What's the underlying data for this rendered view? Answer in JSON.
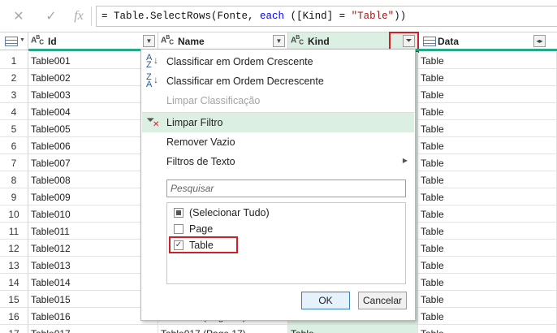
{
  "formula_bar": {
    "cancel_icon": "x-icon",
    "commit_icon": "check-icon",
    "fx_label": "fx",
    "formula_parts": [
      "= Table.SelectRows(Fonte, ",
      "each",
      " ([Kind] = ",
      "\"Table\"",
      "))"
    ]
  },
  "columns": [
    {
      "name": "Id",
      "type_label": "ABC"
    },
    {
      "name": "Name",
      "type_label": "ABC"
    },
    {
      "name": "Kind",
      "type_label": "ABC"
    },
    {
      "name": "Data",
      "type_label": "Table"
    }
  ],
  "rows": [
    {
      "n": "1",
      "id": "Table001",
      "name": "",
      "kind": "",
      "data": "Table"
    },
    {
      "n": "2",
      "id": "Table002",
      "name": "",
      "kind": "",
      "data": "Table"
    },
    {
      "n": "3",
      "id": "Table003",
      "name": "",
      "kind": "",
      "data": "Table"
    },
    {
      "n": "4",
      "id": "Table004",
      "name": "",
      "kind": "",
      "data": "Table"
    },
    {
      "n": "5",
      "id": "Table005",
      "name": "",
      "kind": "",
      "data": "Table"
    },
    {
      "n": "6",
      "id": "Table006",
      "name": "",
      "kind": "",
      "data": "Table"
    },
    {
      "n": "7",
      "id": "Table007",
      "name": "",
      "kind": "",
      "data": "Table"
    },
    {
      "n": "8",
      "id": "Table008",
      "name": "",
      "kind": "",
      "data": "Table"
    },
    {
      "n": "9",
      "id": "Table009",
      "name": "",
      "kind": "",
      "data": "Table"
    },
    {
      "n": "10",
      "id": "Table010",
      "name": "",
      "kind": "",
      "data": "Table"
    },
    {
      "n": "11",
      "id": "Table011",
      "name": "",
      "kind": "",
      "data": "Table"
    },
    {
      "n": "12",
      "id": "Table012",
      "name": "",
      "kind": "",
      "data": "Table"
    },
    {
      "n": "13",
      "id": "Table013",
      "name": "",
      "kind": "",
      "data": "Table"
    },
    {
      "n": "14",
      "id": "Table014",
      "name": "",
      "kind": "",
      "data": "Table"
    },
    {
      "n": "15",
      "id": "Table015",
      "name": "",
      "kind": "",
      "data": "Table"
    },
    {
      "n": "16",
      "id": "Table016",
      "name": "Table016 (Page 16)",
      "kind": "Table",
      "data": "Table"
    },
    {
      "n": "17",
      "id": "Table017",
      "name": "Table017 (Page 17)",
      "kind": "Table",
      "data": "Table"
    }
  ],
  "menu": {
    "sort_asc": "Classificar em Ordem Crescente",
    "sort_desc": "Classificar em Ordem Decrescente",
    "clear_sort": "Limpar Classificação",
    "clear_filter": "Limpar Filtro",
    "remove_empty": "Remover Vazio",
    "text_filters": "Filtros de Texto",
    "search_placeholder": "Pesquisar",
    "items": [
      {
        "label": "(Selecionar Tudo)",
        "state": "indeterminate"
      },
      {
        "label": "Page",
        "state": "unchecked"
      },
      {
        "label": "Table",
        "state": "checked"
      }
    ],
    "ok": "OK",
    "cancel": "Cancelar"
  },
  "colors": {
    "kind_column": "#dbf0e3",
    "highlight": "#d21f26",
    "quality_bar": "#27a888"
  }
}
